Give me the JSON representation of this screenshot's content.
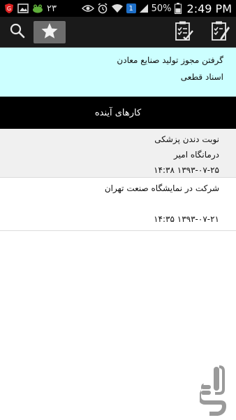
{
  "status_bar": {
    "notification_icons": [
      "shield-icon",
      "gallery-icon",
      "frog-app-icon"
    ],
    "notification_count": "۲۳",
    "battery_percent": "50%",
    "time": "2:49 PM",
    "sim_badge": "1"
  },
  "action_bar": {
    "icons": [
      "search-icon",
      "star-icon",
      "checklist-icon",
      "edit-checklist-icon"
    ]
  },
  "top_item": {
    "title": "گرفتن مجوز تولید صنایع معادن",
    "subtitle": "اسناد قطعی"
  },
  "section": {
    "title": "کارهای آینده"
  },
  "tasks": [
    {
      "title": "نوبت دندن پزشکی",
      "location": "درمانگاه امیر",
      "datetime": "۱۳۹۳-۰۷-۲۵ ۱۴:۳۸"
    },
    {
      "title": "شرکت در نمایشگاه صنعت تهران",
      "location": "",
      "datetime": "۱۳۹۳-۰۷-۲۱ ۱۴:۳۵"
    }
  ],
  "colors": {
    "highlight": "#ccffff",
    "header_bg": "#000000",
    "actionbar_bg": "#1a1a1a"
  }
}
